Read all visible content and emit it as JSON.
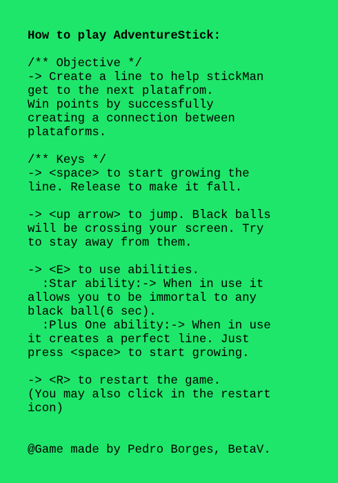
{
  "help": {
    "title": "How to play AdventureStick:",
    "objective": {
      "header": "/** Objective */",
      "lines": [
        "-> Create a line to help stickMan",
        "get to the next platafrom.",
        "Win points by successfully",
        "creating a connection between",
        "plataforms."
      ]
    },
    "keys": {
      "header": "/** Keys */",
      "space": [
        "-> <space> to start growing the",
        "line. Release to make it fall."
      ],
      "jump": [
        "-> <up arrow> to jump. Black balls",
        "will be crossing your screen. Try",
        "to stay away from them."
      ],
      "abilities": [
        "-> <E> to use abilities.",
        "  :Star ability:-> When in use it",
        "allows you to be immortal to any",
        "black ball(6 sec).",
        "  :Plus One ability:-> When in use",
        "it creates a perfect line. Just",
        "press <space> to start growing."
      ],
      "restart": [
        "-> <R> to restart the game.",
        "(You may also click in the restart",
        "icon)"
      ]
    },
    "credits": "@Game made by Pedro Borges, BetaV."
  }
}
